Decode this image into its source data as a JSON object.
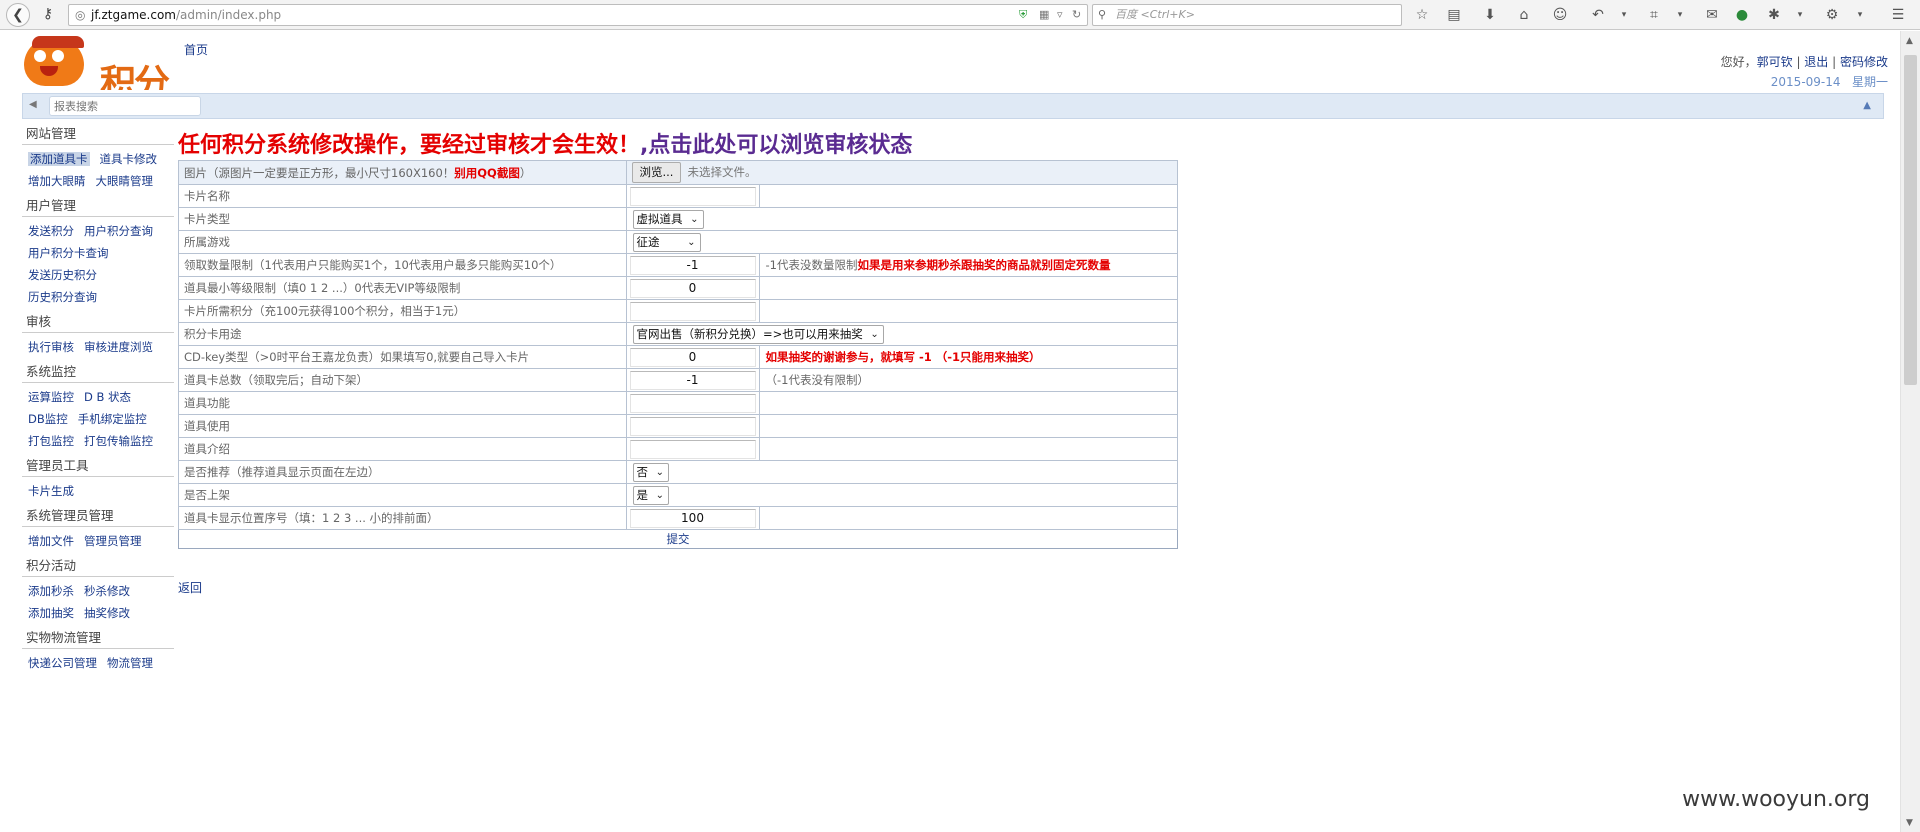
{
  "browser": {
    "url_host": "jf.ztgame.com",
    "url_path": "/admin/index.php",
    "search_placeholder": "百度 <Ctrl+K>"
  },
  "header": {
    "logo_text": "积分",
    "home_link": "首页",
    "greeting": "您好，",
    "username": "郭可钦",
    "logout": "退出",
    "change_password": "密码修改",
    "date": "2015-09-14",
    "weekday": "星期一",
    "search_placeholder": "报表搜索"
  },
  "sidebar": {
    "sections": [
      {
        "title": "网站管理",
        "items": [
          "添加道具卡",
          "道具卡修改",
          "增加大眼睛",
          "大眼睛管理"
        ]
      },
      {
        "title": "用户管理",
        "items": [
          "发送积分",
          "用户积分查询",
          "用户积分卡查询",
          "发送历史积分",
          "历史积分查询"
        ]
      },
      {
        "title": "审核",
        "items": [
          "执行审核",
          "审核进度浏览"
        ]
      },
      {
        "title": "系统监控",
        "items": [
          "运算监控",
          "D B 状态",
          "DB监控",
          "手机绑定监控",
          "打包监控",
          "打包传输监控"
        ]
      },
      {
        "title": "管理员工具",
        "items": [
          "卡片生成"
        ]
      },
      {
        "title": "系统管理员管理",
        "items": [
          "增加文件",
          "管理员管理"
        ]
      },
      {
        "title": "积分活动",
        "items": [
          "添加秒杀",
          "秒杀修改",
          "添加抽奖",
          "抽奖修改"
        ]
      },
      {
        "title": "实物物流管理",
        "items": [
          "快递公司管理",
          "物流管理"
        ]
      }
    ]
  },
  "notice": {
    "part1": "任何积分系统修改操作，要经过审核才会生效！",
    "part2": ",点击此处可以浏览审核状态"
  },
  "form": {
    "image_label": "图片（源图片一定要是正方形，最小尺寸160X160！",
    "image_label_red": "别用QQ截图",
    "image_label_end": "）",
    "browse": "浏览...",
    "no_file": "未选择文件。",
    "rows": {
      "card_name": "卡片名称",
      "card_type": "卡片类型",
      "card_type_value": "虚拟道具",
      "game": "所属游戏",
      "game_value": "征途",
      "limit": "领取数量限制（1代表用户只能购买1个，10代表用户最多只能购买10个）",
      "limit_value": "-1",
      "limit_hint": "-1代表没数量限制",
      "limit_red": "如果是用来参期秒杀跟抽奖的商品就别固定死数量",
      "min_level": "道具最小等级限制（填0 1 2 ...）0代表无VIP等级限制",
      "min_level_value": "0",
      "points": "卡片所需积分（充100元获得100个积分，相当于1元）",
      "usage": "积分卡用途",
      "usage_value": "官网出售（新积分兑换）=>也可以用来抽奖",
      "cdkey": "CD-key类型（>0时平台王嘉龙负责）如果填写0,就要自己导入卡片",
      "cdkey_value": "0",
      "cdkey_red": "如果抽奖的谢谢参与，就填写 -1 （-1只能用来抽奖）",
      "total": "道具卡总数（领取完后；自动下架）",
      "total_value": "-1",
      "total_hint": "（-1代表没有限制）",
      "function": "道具功能",
      "use": "道具使用",
      "intro": "道具介绍",
      "recommend": "是否推荐（推荐道具显示页面在左边）",
      "recommend_value": "否",
      "on_shelf": "是否上架",
      "on_shelf_value": "是",
      "order": "道具卡显示位置序号（填：1 2 3 ... 小的排前面）",
      "order_value": "100"
    },
    "submit": "提交"
  },
  "back_link": "返回",
  "watermark": "www.wooyun.org"
}
